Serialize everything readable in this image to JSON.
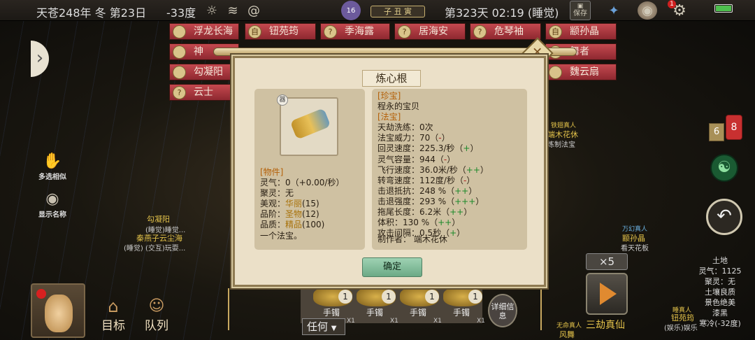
{
  "topbar": {
    "date": "天苍248年 冬 第23日",
    "temperature": "-33度",
    "seal_text": "子 丑 寅",
    "day_time": "第323天 02:19 (睡觉)",
    "save_label": "保存",
    "badge_count": "1",
    "moon_number": "16"
  },
  "name_tabs": [
    {
      "name": "浮龙长海",
      "av": ""
    },
    {
      "name": "钮苑筠",
      "av": "自"
    },
    {
      "name": "季海露",
      "av": "?"
    },
    {
      "name": "居海安",
      "av": "?"
    },
    {
      "name": "危琴袖",
      "av": "?"
    },
    {
      "name": "颛孙晶",
      "av": "自"
    },
    {
      "name": "神",
      "av": ""
    },
    {
      "name": "舞者",
      "av": ""
    },
    {
      "name": "勾凝阳",
      "av": ""
    },
    {
      "name": "魏云扇",
      "av": ""
    },
    {
      "name": "云士",
      "av": "?"
    }
  ],
  "left_labels": {
    "multi_select": "多选相似",
    "show_names": "显示名称",
    "npc1_name": "勾凝阳",
    "npc1_status": "(睡觉)睡觉...",
    "npc2_name": "秦燕子云尘海",
    "npc2_status": "(睡觉) (交互)玩耍..."
  },
  "dialog": {
    "title": "炼心根",
    "item_badge": "器",
    "left_lines": [
      {
        "t": "[物件]",
        "c": "hdr"
      },
      {
        "t": "灵气：0（+0.00/秒）"
      },
      {
        "t": "聚灵：无"
      },
      {
        "t": "美观：",
        "v": "华丽",
        "s": "(15)",
        "c": "yel"
      },
      {
        "t": "品阶：",
        "v": "圣物",
        "s": "(12)",
        "c": "yel"
      },
      {
        "t": "品质：",
        "v": "精品",
        "s": "(100)",
        "c": "yel"
      },
      {
        "t": "一个法宝。"
      }
    ],
    "right_lines": [
      {
        "t": "[珍宝]",
        "c": "hdr"
      },
      {
        "t": "程永的宝贝"
      },
      {
        "t": "[法宝]",
        "c": "hdr"
      },
      {
        "t": "天劫洗练：0次"
      },
      {
        "t": "法宝威力：70（",
        "m": "-",
        "mc": "red",
        "e": "）"
      },
      {
        "t": "回灵速度：225.3/秒（",
        "m": "+",
        "mc": "grn",
        "e": "）"
      },
      {
        "t": "灵气容量：944（",
        "m": "-",
        "mc": "red",
        "e": "）"
      },
      {
        "t": "飞行速度：36.0米/秒（",
        "m": "++",
        "mc": "grn",
        "e": "）"
      },
      {
        "t": "转弯速度：112度/秒（",
        "m": "-",
        "mc": "red",
        "e": "）"
      },
      {
        "t": "击退抵抗：248 %（",
        "m": "++",
        "mc": "grn",
        "e": "）"
      },
      {
        "t": "击退强度：293 %（",
        "m": "+++",
        "mc": "grn",
        "e": "）"
      },
      {
        "t": "拖尾长度：6.2米（",
        "m": "++",
        "mc": "grn",
        "e": "）"
      },
      {
        "t": "体积：130 %（",
        "m": "++",
        "mc": "grn",
        "e": "）"
      },
      {
        "t": "攻击间隔：0.5秒（",
        "m": "+",
        "mc": "grn",
        "e": "）"
      }
    ],
    "maker": "制作者： 端木花休",
    "ok_label": "确定"
  },
  "right_side": {
    "npc_title": "铁翅真人",
    "npc_name": "端木花休",
    "npc_action": "炼制法宝",
    "badge_left": "6",
    "badge_right": "8",
    "npc2_title": "万幻真人",
    "npc2_name": "颛孙晶",
    "npc2_action": "看天花板",
    "land_lines": [
      "土地",
      "灵气：1125",
      "聚灵：无",
      "土壤良质",
      "景色绝美",
      "漆黑",
      "寒冷(-32度)"
    ],
    "speed_label": "×5",
    "next_label": "三劫真仙",
    "npc3_title": "无命真人",
    "npc3_name": "风舞",
    "npc4_title": "睡真人",
    "npc4_name": "钮苑筠",
    "npc4_action": "(娱乐)娱乐"
  },
  "bottom": {
    "goal_label": "目标",
    "queue_label": "队列",
    "any_label": "任何",
    "detail_label": "详细信息",
    "items": [
      {
        "name": "手镯",
        "count": "1",
        "x": "X1"
      },
      {
        "name": "手镯",
        "count": "1",
        "x": "X1"
      },
      {
        "name": "手镯",
        "count": "1",
        "x": "X1"
      },
      {
        "name": "手镯",
        "count": "1",
        "x": "X1"
      }
    ]
  }
}
